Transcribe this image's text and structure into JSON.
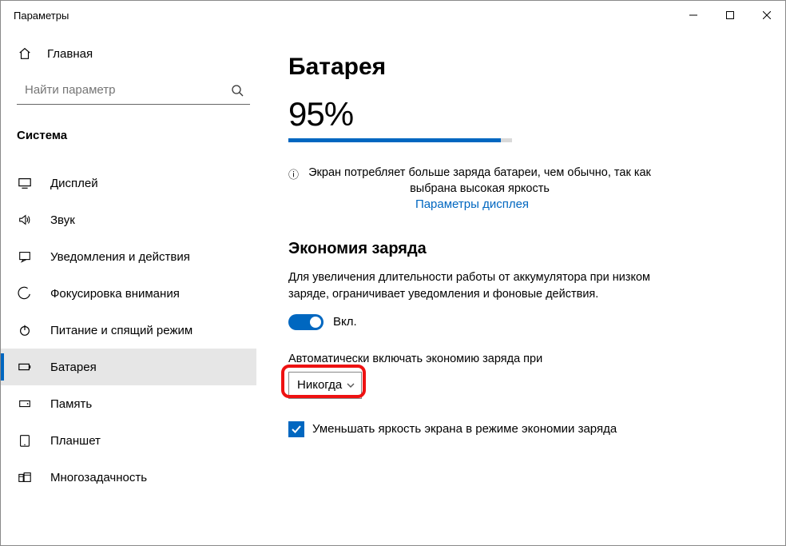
{
  "titlebar": {
    "title": "Параметры"
  },
  "sidebar": {
    "home_label": "Главная",
    "search_placeholder": "Найти параметр",
    "category": "Система",
    "items": [
      {
        "label": "Дисплей",
        "icon": "display"
      },
      {
        "label": "Звук",
        "icon": "sound"
      },
      {
        "label": "Уведомления и действия",
        "icon": "notifications"
      },
      {
        "label": "Фокусировка внимания",
        "icon": "focus"
      },
      {
        "label": "Питание и спящий режим",
        "icon": "power"
      },
      {
        "label": "Батарея",
        "icon": "battery",
        "active": true
      },
      {
        "label": "Память",
        "icon": "storage"
      },
      {
        "label": "Планшет",
        "icon": "tablet"
      },
      {
        "label": "Многозадачность",
        "icon": "multitask"
      }
    ]
  },
  "main": {
    "title": "Батарея",
    "percent": "95%",
    "percent_value": 95,
    "info_text": "Экран потребляет больше заряда батареи, чем обычно, так как выбрана высокая яркость",
    "display_link": "Параметры дисплея",
    "saver_heading": "Экономия заряда",
    "saver_desc": "Для увеличения длительности работы от аккумулятора при низком заряде, ограничивает уведомления и фоновые действия.",
    "toggle_state": "Вкл.",
    "auto_label": "Автоматически включать экономию заряда при",
    "auto_value": "Никогда",
    "reduce_brightness_label": "Уменьшать яркость экрана в режиме экономии заряда",
    "reduce_brightness_checked": true
  }
}
